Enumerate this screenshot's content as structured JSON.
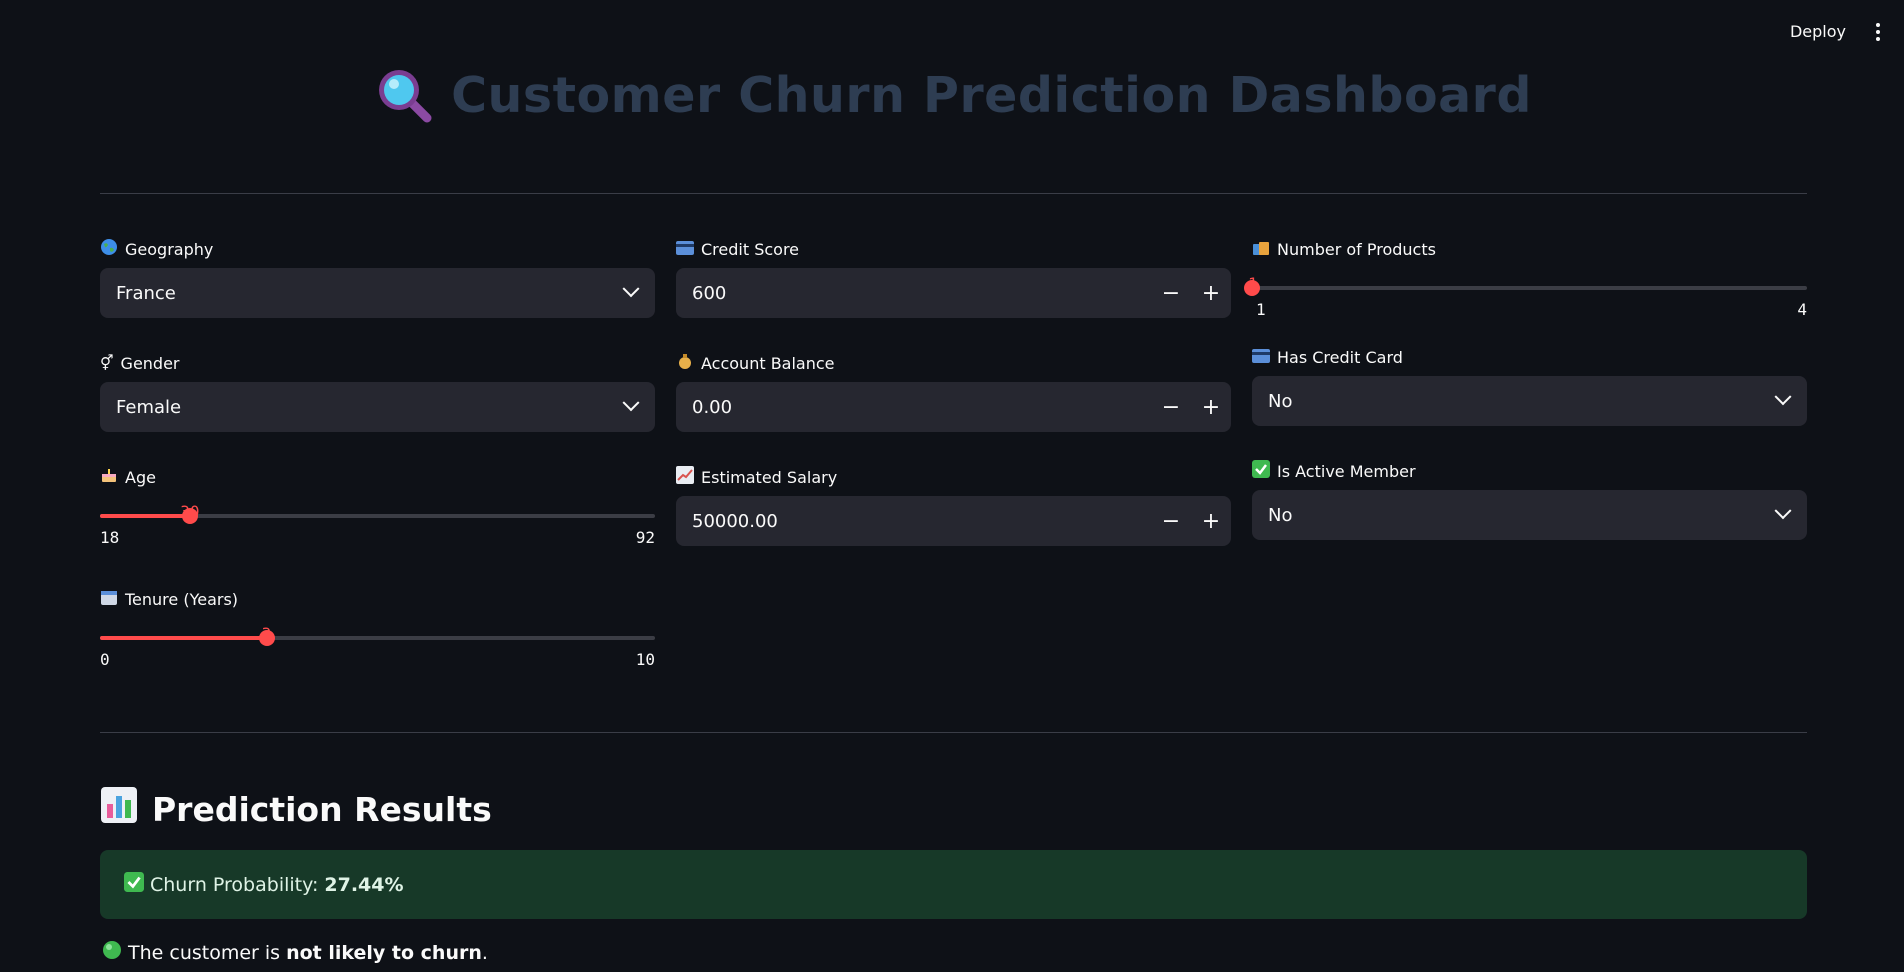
{
  "toolbar": {
    "deploy_label": "Deploy"
  },
  "title": {
    "text": "Customer Churn Prediction Dashboard",
    "icon": "magnifier-icon"
  },
  "inputs": {
    "geography": {
      "label": "Geography",
      "value": "France"
    },
    "gender": {
      "label": "Gender",
      "value": "Female"
    },
    "age": {
      "label": "Age",
      "value": "30",
      "min": "18",
      "max": "92",
      "fraction": 0.162
    },
    "tenure": {
      "label": "Tenure (Years)",
      "value": "3",
      "min": "0",
      "max": "10",
      "fraction": 0.3
    },
    "credit_score": {
      "label": "Credit Score",
      "value": "600"
    },
    "balance": {
      "label": "Account Balance",
      "value": "0.00"
    },
    "salary": {
      "label": "Estimated Salary",
      "value": "50000.00"
    },
    "num_products": {
      "label": "Number of Products",
      "value": "1",
      "min": "1",
      "max": "4",
      "fraction": 0
    },
    "has_credit_card": {
      "label": "Has Credit Card",
      "value": "No"
    },
    "is_active": {
      "label": "Is Active Member",
      "value": "No"
    }
  },
  "stepper": {
    "minus": "−",
    "plus": "+"
  },
  "results": {
    "heading": "Prediction Results",
    "prob_label": "Churn Probability:",
    "prob_value": "27.44%",
    "verdict_prefix": "The customer is",
    "verdict_bold": "not likely to churn",
    "verdict_suffix": "."
  },
  "colors": {
    "accent": "#ff4b4b",
    "background": "#0e1117",
    "success_bg": "#173928"
  }
}
